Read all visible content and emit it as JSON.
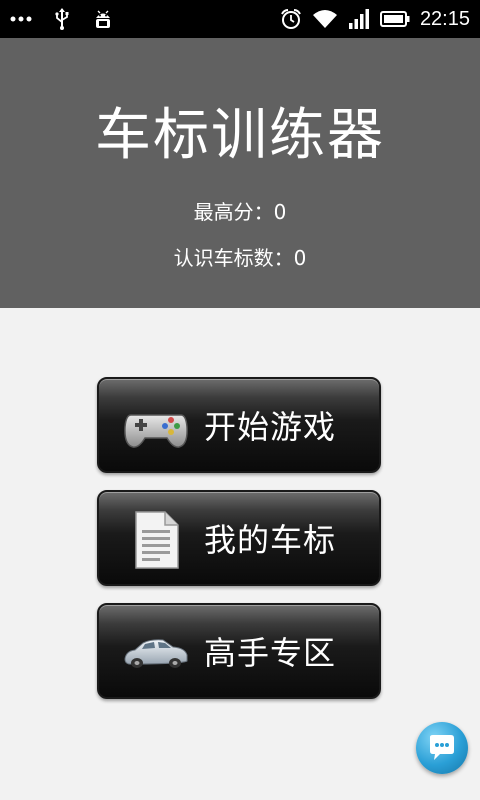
{
  "status_bar": {
    "time": "22:15",
    "icons": [
      "more-dots-icon",
      "usb-icon",
      "android-debug-icon",
      "alarm-icon",
      "wifi-icon",
      "signal-icon",
      "battery-icon"
    ]
  },
  "header": {
    "title": "车标训练器",
    "high_score": "最高分：0",
    "known_logos": "认识车标数：0",
    "background_color": "#616161"
  },
  "menu": {
    "start_game": {
      "label": "开始游戏",
      "icon": "gamepad-icon"
    },
    "my_logos": {
      "label": "我的车标",
      "icon": "document-icon"
    },
    "expert_zone": {
      "label": "高手专区",
      "icon": "car-icon"
    }
  },
  "chat_button": {
    "icon": "chat-bubble-icon",
    "color": "#2a9fd6"
  }
}
